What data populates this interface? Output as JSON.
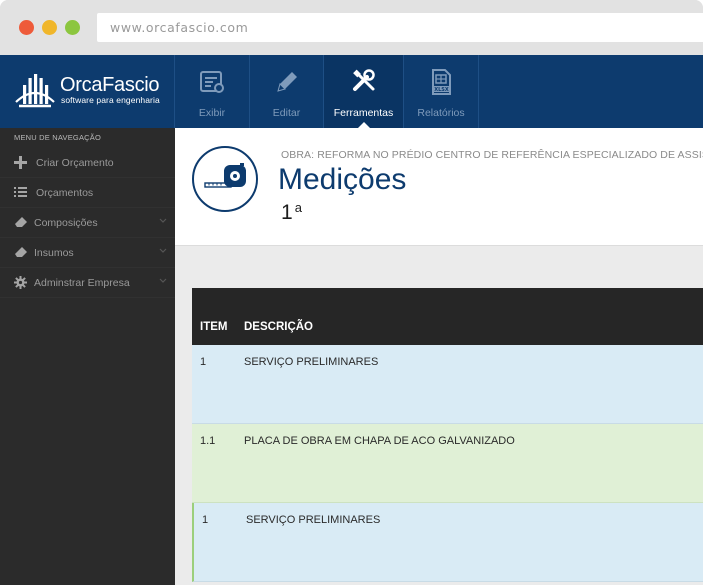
{
  "browser": {
    "url": "www.orcafascio.com"
  },
  "brand": {
    "name": "OrcaFascio",
    "tagline": "software para engenharia",
    "navy": "#0d3b6e"
  },
  "toolbar": {
    "items": [
      {
        "label": "Exibir",
        "icon": "list-view-icon"
      },
      {
        "label": "Editar",
        "icon": "pencil-icon"
      },
      {
        "label": "Ferramentas",
        "icon": "tools-icon",
        "active": true
      },
      {
        "label": "Relatórios",
        "icon": "xlsx-file-icon"
      }
    ]
  },
  "sidebar": {
    "heading": "MENU DE NAVEGAÇÃO",
    "items": [
      {
        "label": "Criar Orçamento",
        "icon": "plus-icon"
      },
      {
        "label": "Orçamentos",
        "icon": "list-icon"
      },
      {
        "label": "Composições",
        "icon": "eraser-icon",
        "expandable": true
      },
      {
        "label": "Insumos",
        "icon": "eraser-icon",
        "expandable": true
      },
      {
        "label": "Adminstrar Empresa",
        "icon": "gear-icon",
        "expandable": true
      }
    ]
  },
  "page": {
    "obra": "OBRA: REFORMA NO PRÉDIO CENTRO DE REFERÊNCIA ESPECIALIZADO DE ASSISTÊNCIA SOCIAL",
    "title": "Medições",
    "number": "1",
    "number_suffix": "a",
    "icon": "tape-measure-icon"
  },
  "table": {
    "headers": {
      "item": "ITEM",
      "descricao": "DESCRIÇÃO"
    },
    "rows": [
      {
        "item": "1",
        "descricao": "SERVIÇO PRELIMINARES",
        "color": "blue"
      },
      {
        "item": "1.1",
        "descricao": "PLACA DE OBRA EM CHAPA DE ACO GALVANIZADO",
        "color": "green"
      },
      {
        "item": "1",
        "descricao": "SERVIÇO PRELIMINARES",
        "color": "blue"
      }
    ]
  }
}
